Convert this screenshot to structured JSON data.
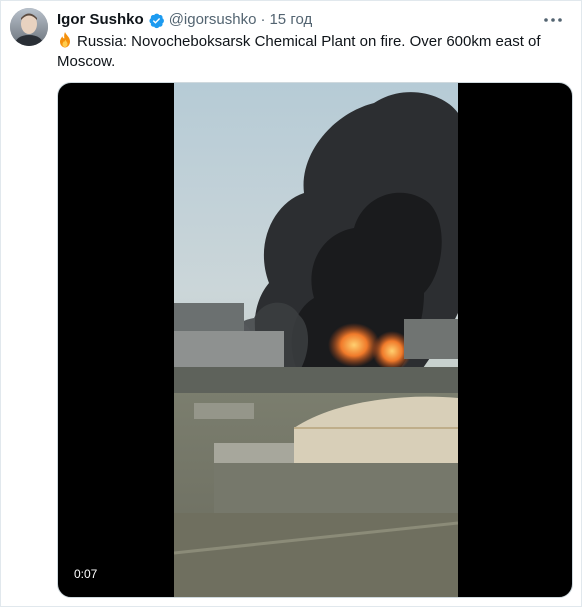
{
  "author": {
    "display_name": "Igor Sushko",
    "handle": "@igorsushko",
    "separator": "·",
    "time": "15 год",
    "avatar_icon": "user-avatar",
    "verified_icon": "verified-badge-icon",
    "verified_color": "#1d9bf0"
  },
  "tweet": {
    "emoji_icon": "fire-emoji",
    "text": "Russia: Novocheboksarsk Chemical Plant on fire. Over 600km east of Moscow."
  },
  "media": {
    "duration": "0:07",
    "background": "#000000"
  },
  "menu": {
    "icon": "more-options-icon"
  }
}
